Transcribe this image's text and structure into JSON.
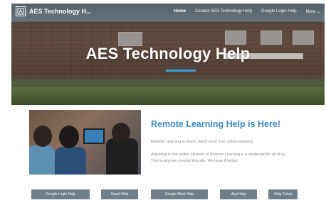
{
  "header": {
    "site_name": "AES Technology H...",
    "nav": [
      "Home",
      "Contact AES Technology Help",
      "Google Login Help",
      "More ⌄"
    ]
  },
  "hero": {
    "title": "AES Technology Help",
    "accent_color": "#3a9fd8"
  },
  "feature": {
    "headline": "Remote Learning Help is Here!",
    "headline_color": "#3d8ac8",
    "para1": "Remote Learning is much, much more than online learning.",
    "para2": "Adjusting to the online element of Remote Learning is a challenge for all of us. That is why we created this site. We hope it helps!"
  },
  "buttons": [
    "Google Login Help",
    "Gmail Help",
    "Google Meet Help",
    "App Help",
    "Help Ticket"
  ],
  "button_color": "#6f7f8a"
}
